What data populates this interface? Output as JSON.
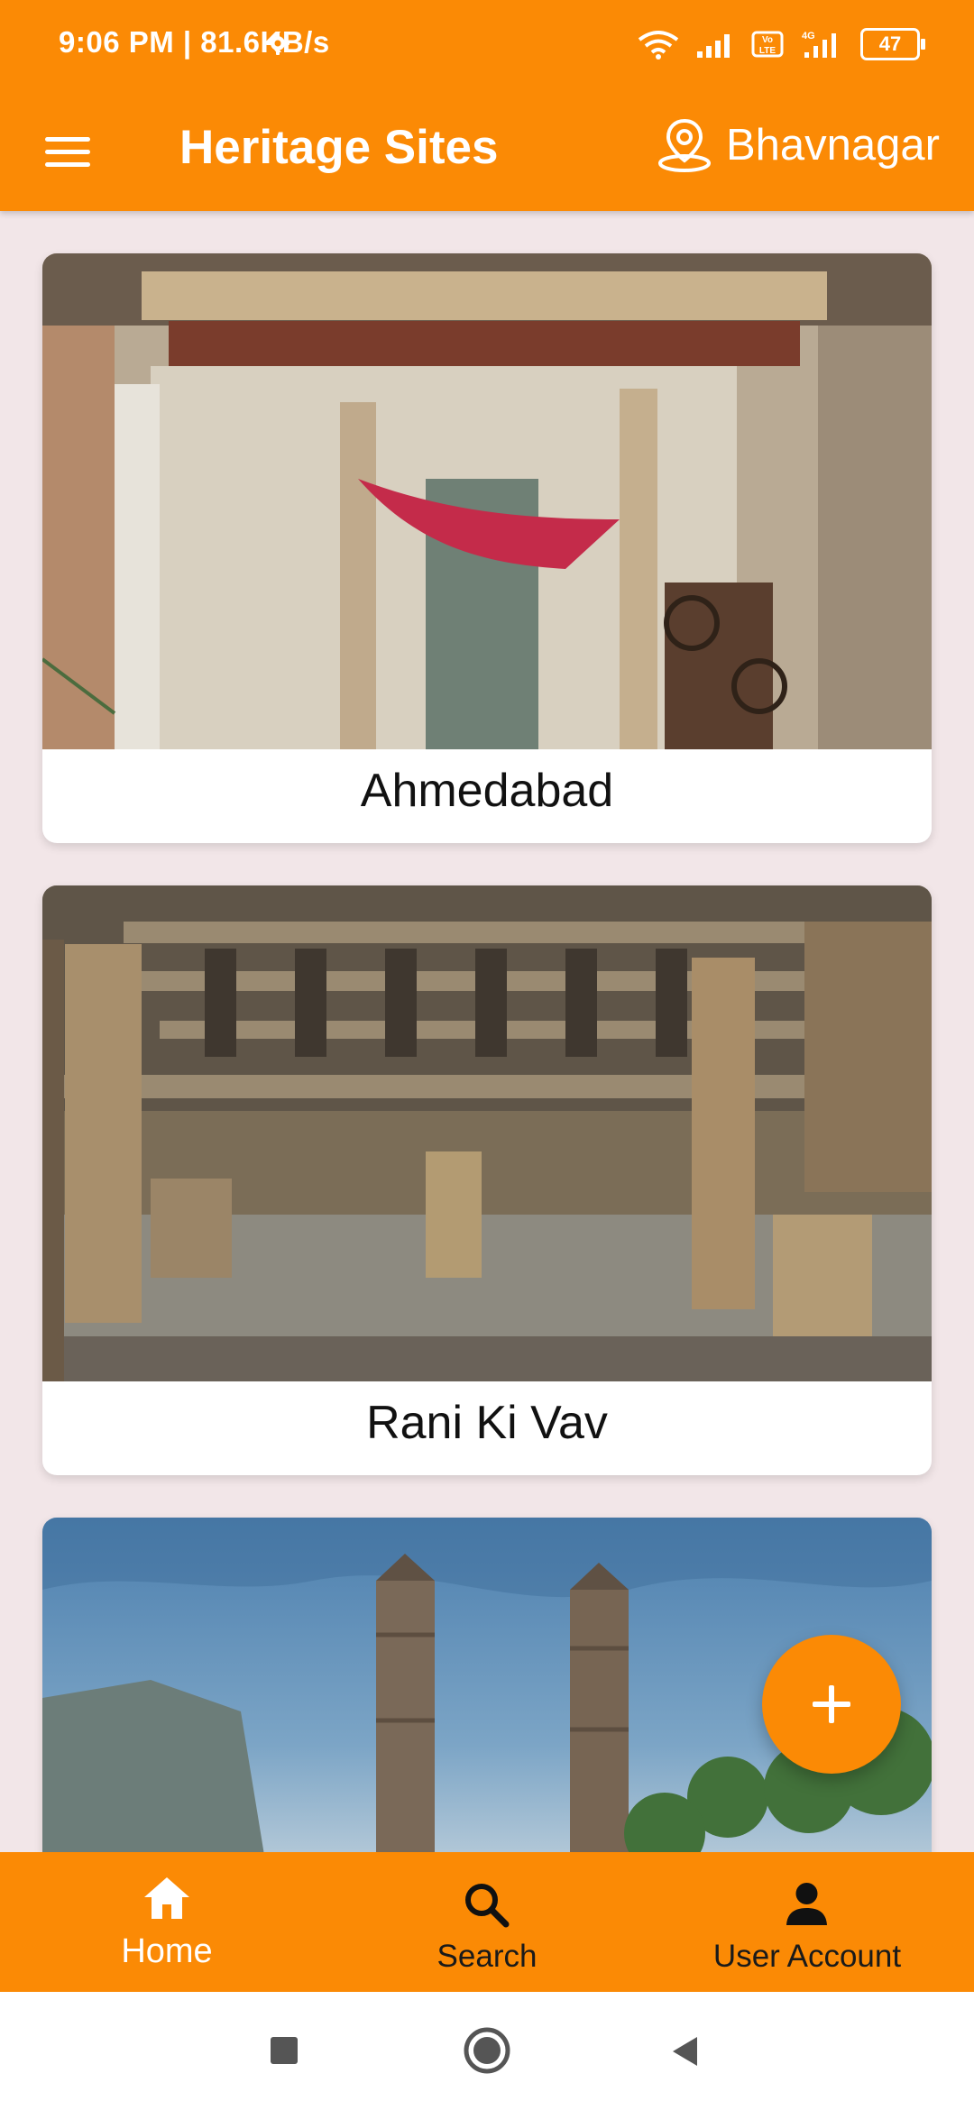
{
  "status_bar": {
    "time": "9:06 PM | 81.6KB/s",
    "battery": "47",
    "icons": [
      "settings-icon",
      "wifi-icon",
      "signal-icon",
      "volte-icon",
      "4g-signal-icon",
      "battery-icon"
    ]
  },
  "app_bar": {
    "title": "Heritage Sites",
    "location": "Bhavnagar",
    "menu_icon": "hamburger-menu-icon",
    "location_icon": "location-pin-icon"
  },
  "sites": [
    {
      "name": "Ahmedabad"
    },
    {
      "name": "Rani Ki Vav"
    },
    {
      "name": ""
    }
  ],
  "fab": {
    "icon": "plus-icon"
  },
  "bottom_nav": {
    "items": [
      {
        "label": "Home",
        "icon": "home-icon"
      },
      {
        "label": "Search",
        "icon": "search-icon"
      },
      {
        "label": "User Account",
        "icon": "user-icon"
      }
    ],
    "active_index": 0
  },
  "system_nav": {
    "icons": [
      "recent-apps-icon",
      "home-circle-icon",
      "back-icon"
    ]
  },
  "colors": {
    "brand": "#fb8a05",
    "background": "#f2e6e8",
    "card": "#ffffff",
    "active_nav_text": "#ffffff",
    "inactive_nav_text": "#1a1a1a"
  }
}
